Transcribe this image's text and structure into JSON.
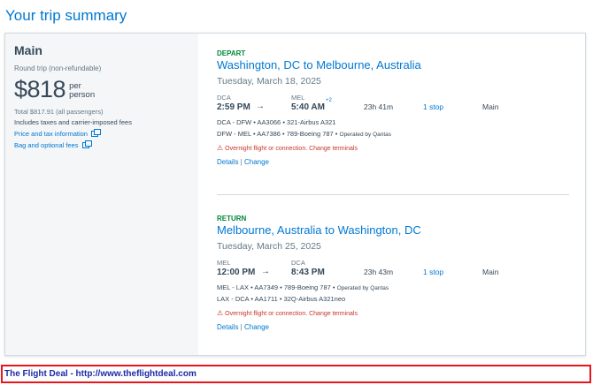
{
  "page": {
    "title": "Your trip summary"
  },
  "fare": {
    "name": "Main",
    "trip_type": "Round trip (non-refundable)",
    "price": "$818",
    "per_line1": "per",
    "per_line2": "person",
    "total": "Total $817.91 (all passengers)",
    "includes": "Includes taxes and carrier-imposed fees",
    "price_tax_link": "Price and tax information",
    "bag_fees_link": "Bag and optional fees"
  },
  "segments": [
    {
      "label": "DEPART",
      "route": "Washington, DC to Melbourne, Australia",
      "date": "Tuesday, March 18, 2025",
      "origin_code": "DCA",
      "dest_code": "MEL",
      "depart_time": "2:59 PM",
      "arrow": "→",
      "arrive_time": "5:40 AM",
      "plus_day": "+2",
      "duration": "23h 41m",
      "stops": "1 stop",
      "cabin": "Main",
      "legs": [
        {
          "text": "DCA - DFW • AA3066 • 321-Airbus A321",
          "operated": ""
        },
        {
          "text": "DFW - MEL • AA7386 • 789-Boeing 787 • ",
          "operated": "Operated by Qantas"
        }
      ],
      "warning": "Overnight flight or connection. Change terminals",
      "details_link": "Details",
      "separator": " | ",
      "change_link": "Change"
    },
    {
      "label": "RETURN",
      "route": "Melbourne, Australia to Washington, DC",
      "date": "Tuesday, March 25, 2025",
      "origin_code": "MEL",
      "dest_code": "DCA",
      "depart_time": "12:00 PM",
      "arrow": "→",
      "arrive_time": "8:43 PM",
      "plus_day": "",
      "duration": "23h 43m",
      "stops": "1 stop",
      "cabin": "Main",
      "legs": [
        {
          "text": "MEL - LAX • AA7349 • 789-Boeing 787 • ",
          "operated": "Operated by Qantas"
        },
        {
          "text": "LAX - DCA • AA1711 • 32Q-Airbus A321neo",
          "operated": ""
        }
      ],
      "warning": "Overnight flight or connection. Change terminals",
      "details_link": "Details",
      "separator": " | ",
      "change_link": "Change"
    }
  ],
  "icons": {
    "external": "external-link-icon",
    "warning": "⚠"
  },
  "footer": {
    "text": "The Flight Deal - http://www.theflightdeal.com"
  },
  "colors": {
    "accent": "#0078d2",
    "green": "#00873c",
    "warning": "#c5362c",
    "footer_border": "#e8151b"
  }
}
